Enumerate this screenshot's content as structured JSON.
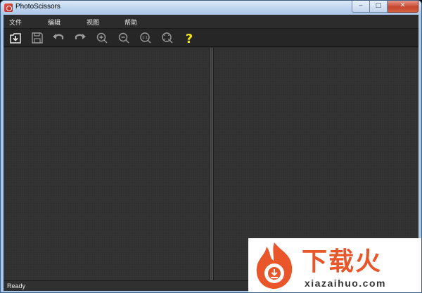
{
  "window": {
    "title": "PhotoScissors"
  },
  "caption": {
    "minimize": "‒",
    "maximize": "□",
    "close": "✕"
  },
  "menu": {
    "items": [
      "文件",
      "编辑",
      "视图",
      "帮助"
    ]
  },
  "toolbar": {
    "tools": [
      {
        "name": "import-icon"
      },
      {
        "name": "save-icon"
      },
      {
        "name": "undo-icon"
      },
      {
        "name": "redo-icon"
      },
      {
        "name": "zoom-in-icon"
      },
      {
        "name": "zoom-out-icon"
      },
      {
        "name": "actual-size-icon",
        "glyph": "1:1"
      },
      {
        "name": "fit-to-window-icon"
      },
      {
        "name": "help-icon",
        "glyph": "?"
      }
    ],
    "help_color": "#f5e500"
  },
  "status": {
    "text": "Ready"
  },
  "watermark": {
    "cn": "下载火",
    "en": "xiazaihuo.com",
    "color": "#e8562a"
  }
}
